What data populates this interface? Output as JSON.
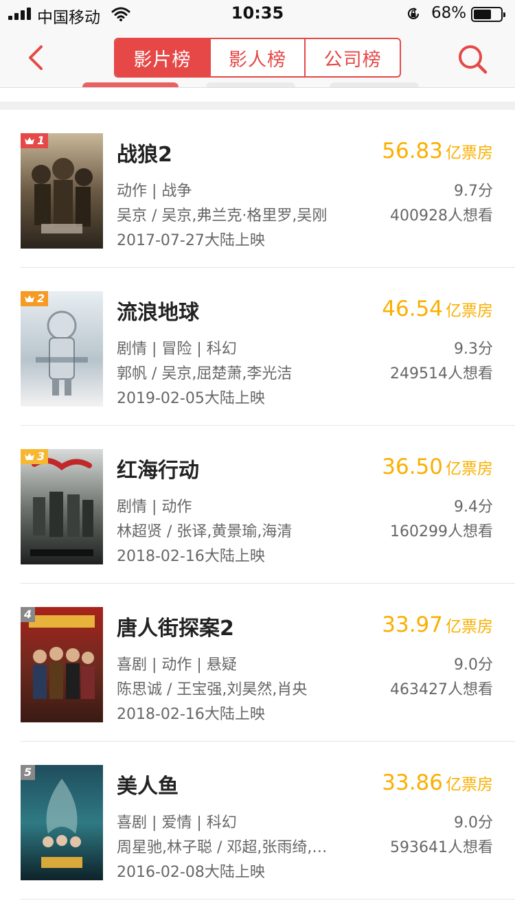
{
  "status_bar": {
    "carrier": "中国移动",
    "time": "10:35",
    "battery": "68%",
    "battery_level": 0.68
  },
  "nav": {
    "tabs": [
      {
        "label": "影片榜",
        "active": true
      },
      {
        "label": "影人榜",
        "active": false
      },
      {
        "label": "公司榜",
        "active": false
      }
    ]
  },
  "colors": {
    "accent": "#e54847",
    "box_office": "#faaf00",
    "rank1": "#e54847",
    "rank2": "#f59a23",
    "rank3": "#f7b731",
    "rank_other": "#888888"
  },
  "movies": [
    {
      "rank": "1",
      "title": "战狼2",
      "categories": "动作 | 战争",
      "cast": "吴京 / 吴京,弗兰克·格里罗,吴刚",
      "release": "2017-07-27大陆上映",
      "box_office": "56.83",
      "box_office_unit": "亿票房",
      "score": "9.7分",
      "wish": "400928人想看"
    },
    {
      "rank": "2",
      "title": "流浪地球",
      "categories": "剧情 | 冒险 | 科幻",
      "cast": "郭帆 / 吴京,屈楚萧,李光洁",
      "release": "2019-02-05大陆上映",
      "box_office": "46.54",
      "box_office_unit": "亿票房",
      "score": "9.3分",
      "wish": "249514人想看"
    },
    {
      "rank": "3",
      "title": "红海行动",
      "categories": "剧情 | 动作",
      "cast": "林超贤 / 张译,黄景瑜,海清",
      "release": "2018-02-16大陆上映",
      "box_office": "36.50",
      "box_office_unit": "亿票房",
      "score": "9.4分",
      "wish": "160299人想看"
    },
    {
      "rank": "4",
      "title": "唐人街探案2",
      "categories": "喜剧 | 动作 | 悬疑",
      "cast": "陈思诚 / 王宝强,刘昊然,肖央",
      "release": "2018-02-16大陆上映",
      "box_office": "33.97",
      "box_office_unit": "亿票房",
      "score": "9.0分",
      "wish": "463427人想看"
    },
    {
      "rank": "5",
      "title": "美人鱼",
      "categories": "喜剧 | 爱情 | 科幻",
      "cast": "周星驰,林子聪 / 邓超,张雨绮,…",
      "release": "2016-02-08大陆上映",
      "box_office": "33.86",
      "box_office_unit": "亿票房",
      "score": "9.0分",
      "wish": "593641人想看"
    }
  ]
}
